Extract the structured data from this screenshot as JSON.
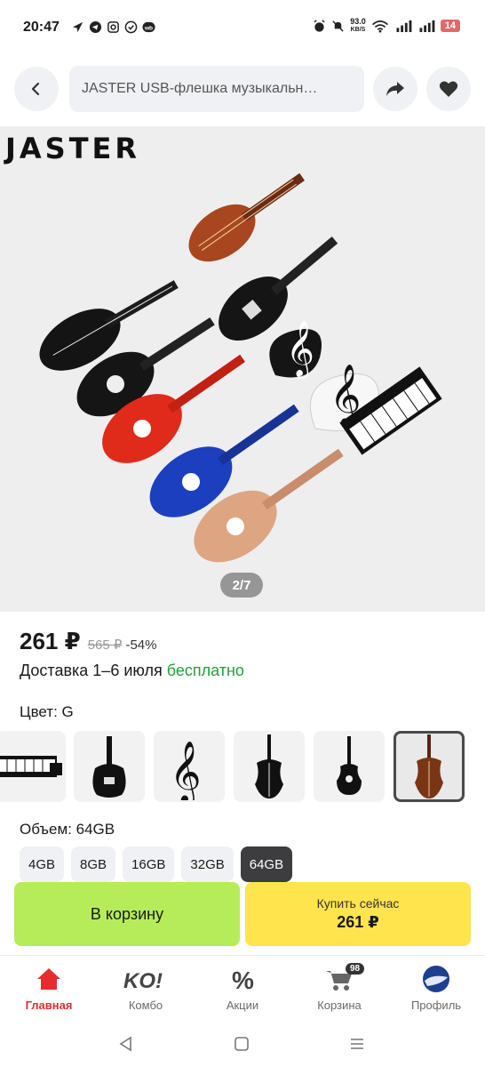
{
  "status_bar": {
    "time": "20:47",
    "net_speed": "93.0",
    "net_unit": "KB/S",
    "battery": "14"
  },
  "header": {
    "search_text": "JASTER USB-флешка музыкальн…",
    "icons": [
      "chevron-left-icon",
      "share-arrow-icon",
      "heart-icon"
    ]
  },
  "gallery": {
    "brand": "JASTER",
    "page_indicator": "2/7"
  },
  "product": {
    "price": "261 ₽",
    "old_price": "565 ₽",
    "discount": "-54%",
    "delivery_prefix": "Доставка 1–6 июля",
    "delivery_free": "бесплатно",
    "color_label": "Цвет: G",
    "volume_label": "Объем: 64GB",
    "sizes": [
      "4GB",
      "8GB",
      "16GB",
      "32GB",
      "64GB"
    ],
    "selected_size": "64GB",
    "variants": [
      "piano",
      "electric-guitar",
      "treble-clef",
      "cello",
      "guitar",
      "violin"
    ],
    "selected_variant": "violin"
  },
  "actions": {
    "add_to_cart": "В корзину",
    "buy_now": "Купить сейчас",
    "buy_price": "261 ₽"
  },
  "bottom_nav": {
    "items": [
      {
        "label": "Главная",
        "icon": "home-icon"
      },
      {
        "label": "Комбо",
        "icon": "ko-logo-icon"
      },
      {
        "label": "Акции",
        "icon": "percent-icon"
      },
      {
        "label": "Корзина",
        "icon": "cart-icon"
      },
      {
        "label": "Профиль",
        "icon": "avatar-icon"
      }
    ],
    "cart_badge": "98"
  },
  "colors": {
    "accent_green": "#b6ec5a",
    "accent_yellow": "#ffe44d",
    "free_green": "#21a038",
    "active_red": "#e52d2d"
  }
}
